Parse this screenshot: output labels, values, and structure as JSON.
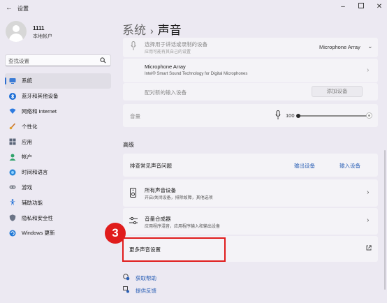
{
  "window": {
    "title": "设置",
    "controls": [
      "minimize",
      "maximize",
      "close"
    ]
  },
  "user": {
    "name": "1111",
    "account_type": "本地帐户"
  },
  "search": {
    "placeholder": "查找设置"
  },
  "sidebar": {
    "items": [
      {
        "label": "系统",
        "icon": "system-icon",
        "active": true
      },
      {
        "label": "蓝牙和其他设备",
        "icon": "bluetooth-icon"
      },
      {
        "label": "网络和 Internet",
        "icon": "wifi-icon"
      },
      {
        "label": "个性化",
        "icon": "brush-icon"
      },
      {
        "label": "应用",
        "icon": "apps-icon"
      },
      {
        "label": "帐户",
        "icon": "account-icon"
      },
      {
        "label": "时间和语言",
        "icon": "globe-icon"
      },
      {
        "label": "游戏",
        "icon": "gamepad-icon"
      },
      {
        "label": "辅助功能",
        "icon": "accessibility-icon"
      },
      {
        "label": "隐私和安全性",
        "icon": "shield-icon"
      },
      {
        "label": "Windows 更新",
        "icon": "update-icon"
      }
    ]
  },
  "breadcrumb": {
    "parent": "系统",
    "separator": "›",
    "current": "声音"
  },
  "input": {
    "choose_device_title": "选择用于讲话或录制的设备",
    "choose_device_sub": "应用可能有其自己的设置",
    "selected_device": "Microphone Array",
    "device_title": "Microphone Array",
    "device_sub": "Intel® Smart Sound Technology for Digital Microphones",
    "pair_label": "配对新的输入设备",
    "add_device_button": "添加设备",
    "volume_label": "音量",
    "volume_value": "100"
  },
  "advanced": {
    "section_label": "高级",
    "troubleshoot_label": "排查常见声音问题",
    "output_device_link": "输出设备",
    "input_device_link": "输入设备",
    "all_devices_title": "所有声音设备",
    "all_devices_sub": "开启/关闭设备，排除故障，其他选项",
    "mixer_title": "音量合成器",
    "mixer_sub": "应用程序混音，应用程序输入和输出设备",
    "more_settings_label": "更多声音设置"
  },
  "footer": {
    "help": "获取帮助",
    "feedback": "提供反馈"
  },
  "annotation": {
    "step": "3"
  },
  "colors": {
    "accent": "#2f6fd0",
    "annotation_red": "#e01c1c",
    "background": "#ece9f2",
    "card": "#f4f3f7"
  }
}
